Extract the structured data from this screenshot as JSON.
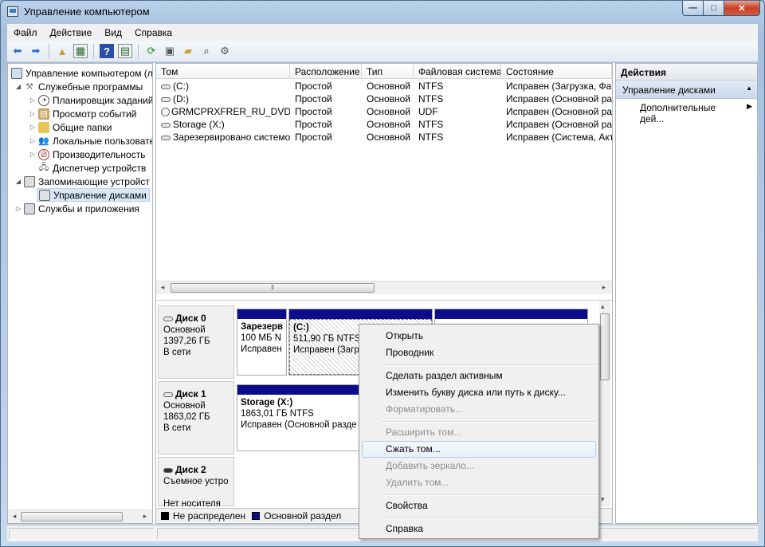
{
  "window": {
    "title": "Управление компьютером",
    "minimize_glyph": "—",
    "maximize_glyph": "□",
    "close_glyph": "✕"
  },
  "menu": [
    "Файл",
    "Действие",
    "Вид",
    "Справка"
  ],
  "toolbar_icons": [
    "back-arrow-icon",
    "forward-arrow-icon",
    "up-folder-icon",
    "show-tree-icon",
    "help-icon",
    "action-pane-icon",
    "refresh-icon",
    "properties-icon",
    "open-folder-icon",
    "search-icon",
    "settings-icon"
  ],
  "tree": {
    "root": "Управление компьютером (л",
    "system_tools": "Служебные программы",
    "task_scheduler": "Планировщик заданий",
    "event_viewer": "Просмотр событий",
    "shared_folders": "Общие папки",
    "local_users": "Локальные пользовате",
    "performance": "Производительность",
    "device_manager": "Диспетчер устройств",
    "storage": "Запоминающие устройст",
    "disk_management": "Управление дисками",
    "services": "Службы и приложения"
  },
  "volumes": {
    "columns": [
      "Том",
      "Расположение",
      "Тип",
      "Файловая система",
      "Состояние"
    ],
    "rows": [
      {
        "name": "(C:)",
        "layout": "Простой",
        "type": "Основной",
        "fs": "NTFS",
        "status": "Исправен (Загрузка, Фай"
      },
      {
        "name": "(D:)",
        "layout": "Простой",
        "type": "Основной",
        "fs": "NTFS",
        "status": "Исправен (Основной раз"
      },
      {
        "name": "GRMCPRXFRER_RU_DVD (F:)",
        "layout": "Простой",
        "type": "Основной",
        "fs": "UDF",
        "status": "Исправен (Основной раз"
      },
      {
        "name": "Storage (X:)",
        "layout": "Простой",
        "type": "Основной",
        "fs": "NTFS",
        "status": "Исправен (Основной раз"
      },
      {
        "name": "Зарезервировано системой",
        "layout": "Простой",
        "type": "Основной",
        "fs": "NTFS",
        "status": "Исправен (Система, Акти"
      }
    ],
    "scroll_grip": "⦀"
  },
  "disks": {
    "disk0": {
      "name": "Диск 0",
      "type": "Основной",
      "size": "1397,26 ГБ",
      "status": "В сети"
    },
    "disk1": {
      "name": "Диск 1",
      "type": "Основной",
      "size": "1863,02 ГБ",
      "status": "В сети"
    },
    "disk2": {
      "name": "Диск 2",
      "type": "Съемное устрой",
      "status": "Нет носителя"
    },
    "partitions": {
      "reserved": {
        "title": "Зарезерв",
        "size": "100 МБ N",
        "status": "Исправен"
      },
      "c": {
        "title": "(C:)",
        "size": "511,90 ГБ NTFS",
        "status": "Исправен (Загр"
      },
      "storage": {
        "title": "Storage  (X:)",
        "size": "1863,01 ГБ NTFS",
        "status": "Исправен (Основной разде"
      }
    }
  },
  "legend": {
    "unallocated": "Не распределен",
    "primary": "Основной раздел",
    "unallocated_color": "#000000",
    "primary_color": "#0a0c8c"
  },
  "actions": {
    "title": "Действия",
    "section": "Управление дисками",
    "more": "Дополнительные дей..."
  },
  "context_menu": {
    "open": "Открыть",
    "explorer": "Проводник",
    "make_active": "Сделать раздел активным",
    "change_letter": "Изменить букву диска или путь к диску...",
    "format": "Форматировать...",
    "extend": "Расширить том...",
    "shrink": "Сжать том...",
    "add_mirror": "Добавить зеркало...",
    "delete": "Удалить том...",
    "properties": "Свойства",
    "help": "Справка"
  }
}
